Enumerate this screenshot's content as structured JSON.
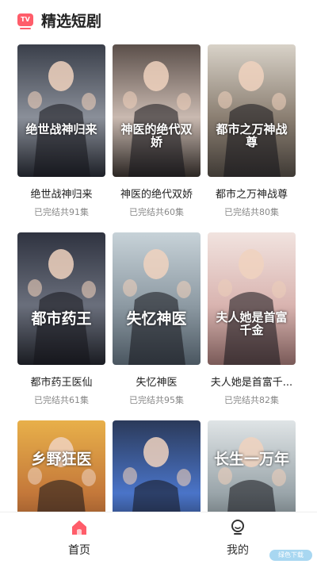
{
  "header": {
    "icon": "tv-icon",
    "icon_text": "TV",
    "title": "精选短剧",
    "accent": "#ff5d6a"
  },
  "dramas": [
    {
      "title": "绝世战神归来",
      "status": "已完结共91集",
      "poster_text": "绝世战神归来",
      "colors": [
        "#3a3f4a",
        "#8a8f99",
        "#1d2027"
      ]
    },
    {
      "title": "神医的绝代双娇",
      "status": "已完结共60集",
      "poster_text": "神医的绝代双娇",
      "colors": [
        "#5b4f4a",
        "#c9b9b0",
        "#2b2623"
      ]
    },
    {
      "title": "都市之万神战尊",
      "status": "已完结共80集",
      "poster_text": "都市之万神战尊",
      "colors": [
        "#d8d2c8",
        "#8b7f72",
        "#3f3a35"
      ]
    },
    {
      "title": "都市药王医仙",
      "status": "已完结共61集",
      "poster_text": "都市药王",
      "colors": [
        "#2f3340",
        "#6a6f7c",
        "#1a1c22"
      ]
    },
    {
      "title": "失忆神医",
      "status": "已完结共95集",
      "poster_text": "失忆神医",
      "colors": [
        "#c7d2d8",
        "#8d9aa3",
        "#4a5660"
      ]
    },
    {
      "title": "夫人她是首富千...",
      "status": "已完结共82集",
      "poster_text": "夫人她是首富千金",
      "colors": [
        "#f1e3df",
        "#d9b4b0",
        "#7a5a58"
      ]
    },
    {
      "title": "",
      "status": "",
      "poster_text": "乡野狂医",
      "colors": [
        "#e8b04a",
        "#c4783a",
        "#6b3a20"
      ]
    },
    {
      "title": "",
      "status": "",
      "poster_text": "",
      "colors": [
        "#2b3a5a",
        "#4a74c8",
        "#111827"
      ]
    },
    {
      "title": "",
      "status": "",
      "poster_text": "长生一万年",
      "colors": [
        "#dfe4e6",
        "#9aa5aa",
        "#3d4649"
      ]
    }
  ],
  "tabbar": {
    "home": {
      "label": "首页",
      "icon": "home-icon",
      "color": "#ff5d6a"
    },
    "mine": {
      "label": "我的",
      "icon": "profile-icon",
      "color": "#333333"
    }
  },
  "watermark": {
    "text": "绿色下载"
  }
}
